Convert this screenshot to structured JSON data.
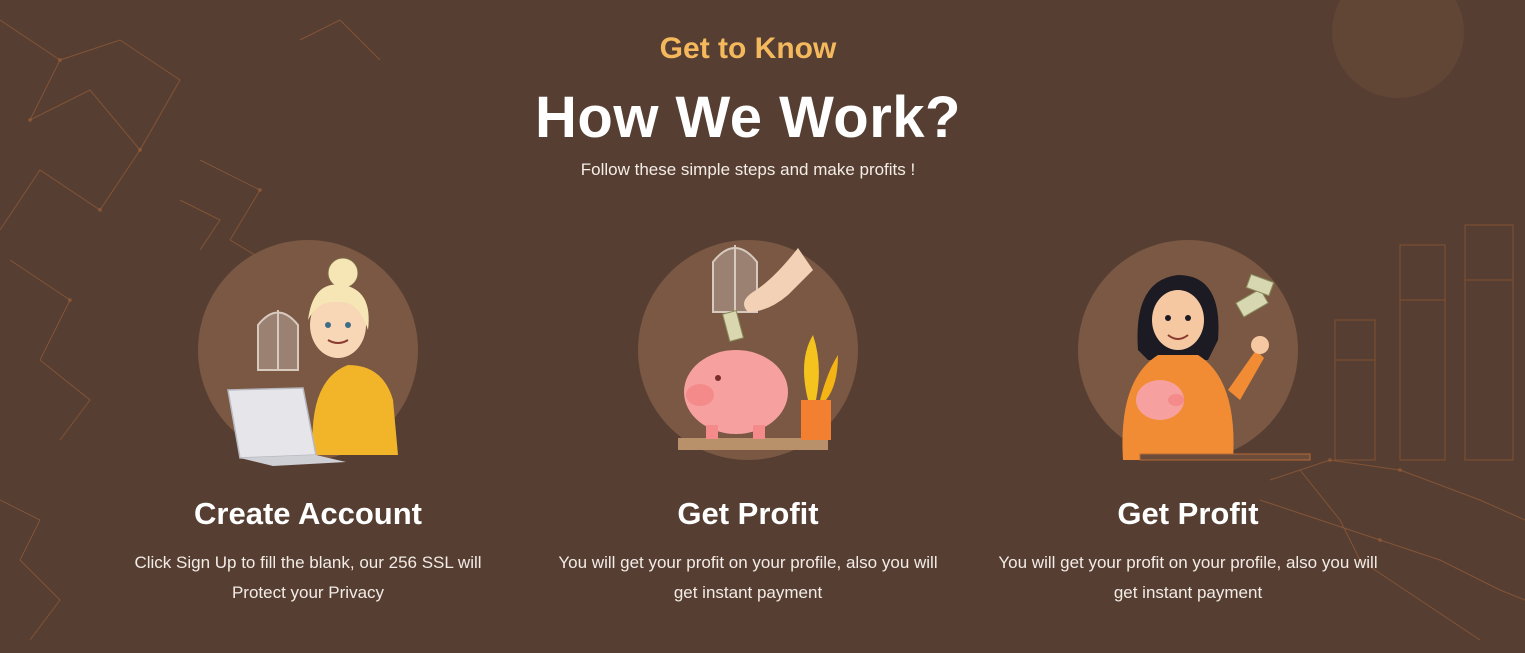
{
  "section": {
    "eyebrow": "Get to Know",
    "title": "How We Work?",
    "subtitle": "Follow these simple steps and make profits !"
  },
  "steps": [
    {
      "title": "Create Account",
      "description": "Click Sign Up to fill the blank, our 256 SSL will Protect your Privacy",
      "illustration": "woman-with-laptop-illustration"
    },
    {
      "title": "Get Profit",
      "description": "You will get your profit on your profile, also you will get instant payment",
      "illustration": "piggy-bank-deposit-illustration"
    },
    {
      "title": "Get Profit",
      "description": "You will get your profit on your profile, also you will get instant payment",
      "illustration": "woman-with-money-illustration"
    }
  ],
  "colors": {
    "background": "#563f32",
    "accent": "#f5b95d",
    "circle": "#7a5843",
    "decor_lines": "#c8733a"
  }
}
